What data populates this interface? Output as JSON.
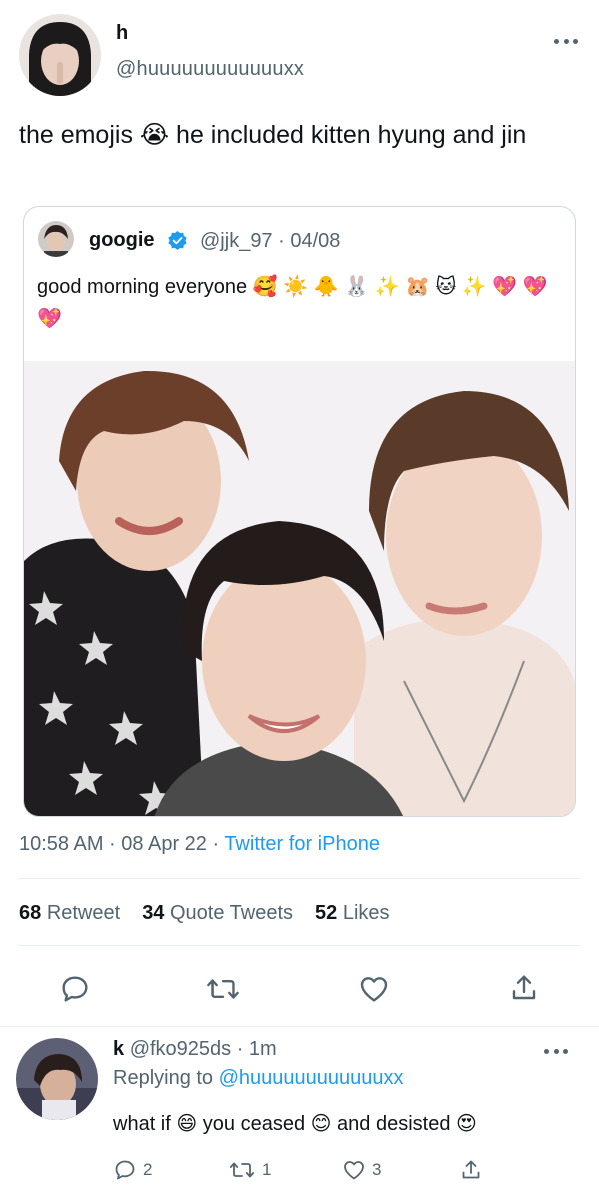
{
  "tweet": {
    "author_name": "h",
    "author_handle": "@huuuuuuuuuuuuxx",
    "text": "the emojis 😭  he included kitten hyung and jin"
  },
  "quote": {
    "name": "googie",
    "handle_date": "@jjk_97 · 04/08",
    "text": "good morning everyone 🥰 ☀️ 🐥 🐰 ✨ 🐹 🐱 ✨ 💖 💖 💖"
  },
  "meta": {
    "time_date": "10:58 AM · 08 Apr 22 · ",
    "source": "Twitter for iPhone"
  },
  "stats": {
    "retweets_count": "68",
    "retweets_label": "Retweet",
    "quotes_count": "34",
    "quotes_label": "Quote Tweets",
    "likes_count": "52",
    "likes_label": "Likes"
  },
  "reply": {
    "name": "k",
    "handle_time": "@fko925ds · 1m",
    "replying_label": "Replying to ",
    "replying_handle": "@huuuuuuuuuuuuxx",
    "text": "what if 😄  you ceased 😊  and desisted 😍",
    "comment_count": "2",
    "retweet_count": "1",
    "like_count": "3"
  },
  "icons": {
    "reply": "comment-bubble-icon",
    "retweet": "retweet-arrows-icon",
    "like": "heart-outline-icon",
    "share": "share-upload-icon",
    "more": "three-dots-icon",
    "verified": "verified-badge-icon"
  },
  "colors": {
    "link": "#1d9bf0",
    "secondary_text": "#536471",
    "primary_text": "#0f1419",
    "divider": "#e6ecf0"
  }
}
